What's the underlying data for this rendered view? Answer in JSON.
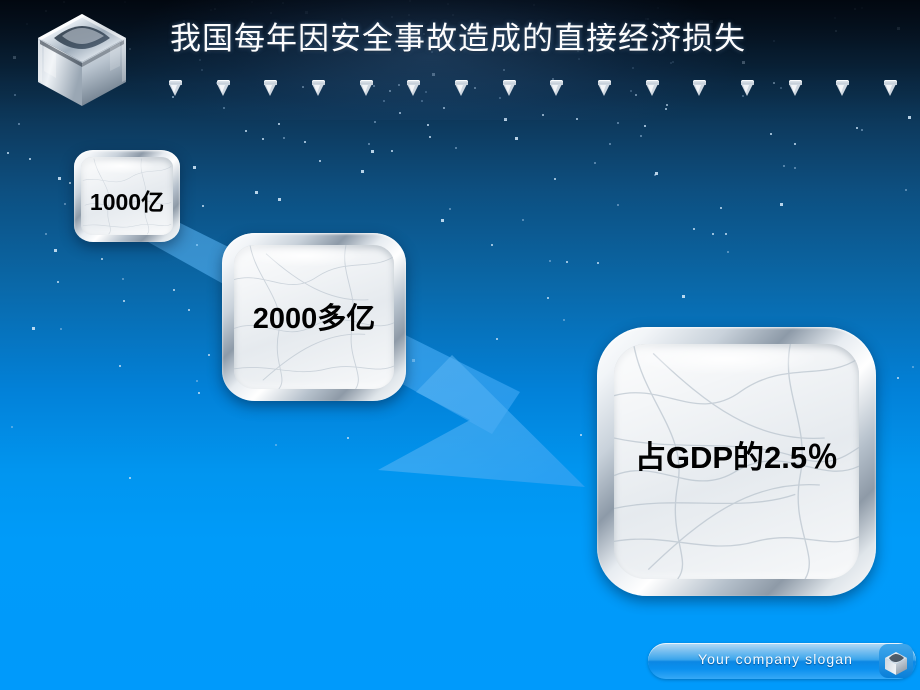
{
  "slide": {
    "title": "我国每年因安全事故造成的直接经济损失",
    "background": {
      "top_color": "#020a14",
      "mid_color": "#0a68a8",
      "bottom_color": "#009afb",
      "header_color": "#051221",
      "accent_color": "#3fa6f0"
    }
  },
  "header": {
    "logo_name": "metallic-cube-logo",
    "gem_count": 16
  },
  "boxes": [
    {
      "id": "box1",
      "label": "1000亿"
    },
    {
      "id": "box2",
      "label": "2000多亿"
    },
    {
      "id": "box3",
      "label": "占GDP的2.5％"
    }
  ],
  "arrow": {
    "name": "progression-arrow",
    "color": "#3fa6f0",
    "direction": "down-right"
  },
  "footer": {
    "slogan": "Your company slogan",
    "icon_name": "cube-icon"
  }
}
